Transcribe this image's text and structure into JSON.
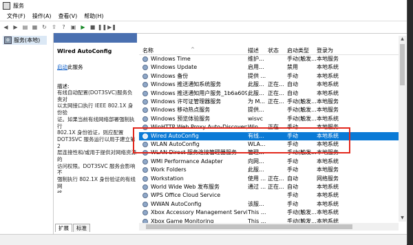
{
  "window": {
    "title": "服务"
  },
  "menu": [
    "文件(F)",
    "操作(A)",
    "查看(V)",
    "帮助(H)"
  ],
  "toolbar_icons": [
    "back-icon",
    "forward-icon",
    "console-tree-icon",
    "properties-icon",
    "refresh-icon",
    "export-icon",
    "help-icon",
    "view-icon",
    "play-icon",
    "stop-icon",
    "pause-icon",
    "restart-icon"
  ],
  "tree": {
    "root_label": "服务(本地)"
  },
  "detail": {
    "service_name": "Wired AutoConfig",
    "start_link": "启动",
    "start_suffix": "此服务",
    "desc_label": "描述:",
    "desc_lines": [
      "有线自动配置(DOT3SVC)服务负责对",
      "以太网接口执行 IEEE 802.1X 身份验",
      "证。如果当前有线网络部署强制执行",
      "802.1X 身份验证，则应配置",
      "DOT3SVC 服务运行以用于建立第 2",
      "层连接性和/或用于提供对网络资源的",
      "访问权限。DOT3SVC 服务会影响不",
      "强制执行 802.1X 身份验证的有线网",
      "络。"
    ]
  },
  "tabs": [
    "扩展",
    "标准"
  ],
  "columns": {
    "name": "名称",
    "desc": "描述",
    "status": "状态",
    "startup": "启动类型",
    "logon": "登录为"
  },
  "services": [
    {
      "name": "Windows Time",
      "desc": "维护...",
      "status": "",
      "startup": "手动(触发...",
      "logon": "本地服务"
    },
    {
      "name": "Windows Update",
      "desc": "启用...",
      "status": "",
      "startup": "禁用",
      "logon": "本地系统"
    },
    {
      "name": "Windows 备份",
      "desc": "提供 ...",
      "status": "",
      "startup": "手动",
      "logon": "本地系统"
    },
    {
      "name": "Windows 推送通知系统服务",
      "desc": "此服...",
      "status": "正在...",
      "startup": "自动",
      "logon": "本地系统"
    },
    {
      "name": "Windows 推送通知用户服务_1b6a609a6",
      "desc": "此服...",
      "status": "正在...",
      "startup": "自动",
      "logon": "本地系统"
    },
    {
      "name": "Windows 许可证管理器服务",
      "desc": "为 M...",
      "status": "正在...",
      "startup": "手动(触发...",
      "logon": "本地服务"
    },
    {
      "name": "Windows 移动热点服务",
      "desc": "提供...",
      "status": "",
      "startup": "手动(触发...",
      "logon": "本地服务"
    },
    {
      "name": "Windows 预览体验服务",
      "desc": "wisvc",
      "status": "",
      "startup": "手动(触发...",
      "logon": "本地系统"
    },
    {
      "name": "WinHTTP Web Proxy Auto-Discovery ...",
      "desc": "Win...",
      "status": "正在...",
      "startup": "手动",
      "logon": "本地服务"
    },
    {
      "name": "Wired AutoConfig",
      "desc": "有线...",
      "status": "",
      "startup": "手动",
      "logon": "本地系统"
    },
    {
      "name": "WLAN AutoConfig",
      "desc": "WLA...",
      "status": "",
      "startup": "手动",
      "logon": "本地系统"
    },
    {
      "name": "WLAN Direct 服务连接管理器服务",
      "desc": "管理...",
      "status": "",
      "startup": "手动(触发...",
      "logon": "本地服务"
    },
    {
      "name": "WMI Performance Adapter",
      "desc": "向网...",
      "status": "",
      "startup": "手动",
      "logon": "本地系统"
    },
    {
      "name": "Work Folders",
      "desc": "此服...",
      "status": "",
      "startup": "手动",
      "logon": "本地服务"
    },
    {
      "name": "Workstation",
      "desc": "使用 ...",
      "status": "正在...",
      "startup": "自动",
      "logon": "网络服务"
    },
    {
      "name": "World Wide Web 发布服务",
      "desc": "通过 ...",
      "status": "正在...",
      "startup": "自动",
      "logon": "本地系统"
    },
    {
      "name": "WPS Office Cloud Service",
      "desc": "",
      "status": "",
      "startup": "手动",
      "logon": "本地系统"
    },
    {
      "name": "WWAN AutoConfig",
      "desc": "该服...",
      "status": "",
      "startup": "手动",
      "logon": "本地系统"
    },
    {
      "name": "Xbox Accessory Management Service",
      "desc": "This ...",
      "status": "",
      "startup": "手动(触发...",
      "logon": "本地系统"
    },
    {
      "name": "Xbox Game Monitoring",
      "desc": "This ...",
      "status": "",
      "startup": "手动(触发...",
      "logon": "本地系统"
    }
  ],
  "selected_service": "Wired AutoConfig",
  "colors": {
    "selection": "#0a7ad6",
    "highlight_box": "#e2261b",
    "link": "#0b5cc7"
  }
}
